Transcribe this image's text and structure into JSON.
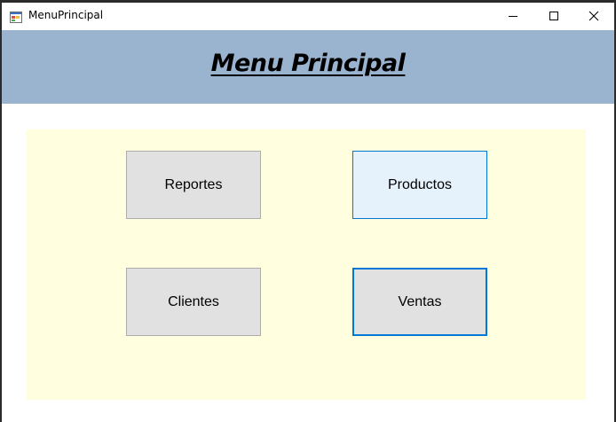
{
  "window": {
    "title": "MenuPrincipal",
    "icon": "form-app-icon",
    "controls": {
      "minimize": "minimize-icon",
      "maximize": "maximize-icon",
      "close": "close-icon"
    }
  },
  "header": {
    "title": "Menu Principal",
    "background": "#9ab3cf"
  },
  "panel": {
    "background": "#ffffe0"
  },
  "buttons": {
    "reportes": "Reportes",
    "productos": "Productos",
    "clientes": "Clientes",
    "ventas": "Ventas"
  },
  "colors": {
    "button_face": "#e1e1e1",
    "hover_face": "#e5f1fb",
    "focus_border": "#0078d7"
  }
}
